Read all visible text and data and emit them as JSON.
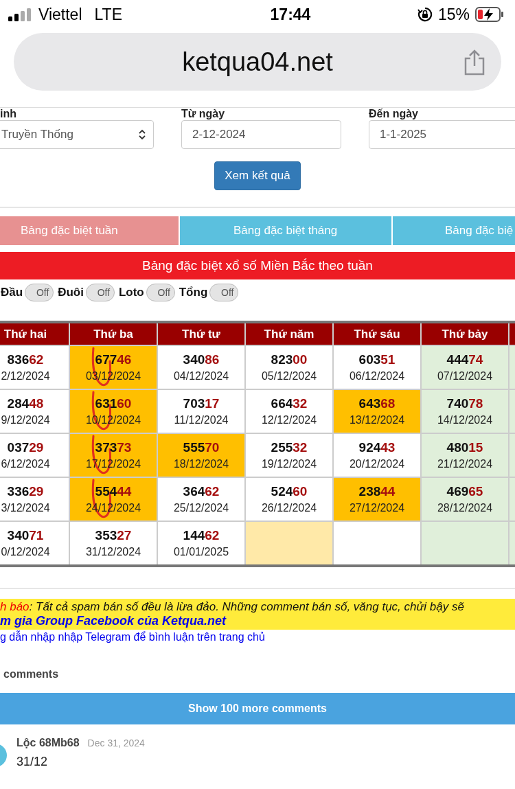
{
  "status_bar": {
    "carrier": "Viettel",
    "network": "LTE",
    "time": "17:44",
    "battery": "15%"
  },
  "address_bar": {
    "url": "ketqua04.net"
  },
  "filters": [
    {
      "kind": "select",
      "label": "inh",
      "value": "Truyền Thống"
    },
    {
      "kind": "date",
      "label": "Từ ngày",
      "value": "2-12-2024"
    },
    {
      "kind": "date",
      "label": "Đến ngày",
      "value": "1-1-2025"
    }
  ],
  "submit_button": "Xem kết quả",
  "tabs": [
    {
      "label": "Bảng đặc biệt tuần",
      "selected": true
    },
    {
      "label": "Bảng đặc biệt tháng",
      "selected": false
    },
    {
      "label": "Bảng đặc biệ",
      "selected": false
    }
  ],
  "banner": "Bảng đặc biệt xổ số Miền Bắc theo tuần",
  "toggles": [
    {
      "label": "Đầu",
      "state": "Off",
      "on": false
    },
    {
      "label": "Đuôi",
      "state": "Off",
      "on": false
    },
    {
      "label": "Loto",
      "state": "Off",
      "on": false
    },
    {
      "label": "Tổng",
      "state": "Off",
      "on": false
    }
  ],
  "table": {
    "columns": [
      {
        "label": "Thứ hai",
        "weekend": false
      },
      {
        "label": "Thứ ba",
        "weekend": false
      },
      {
        "label": "Thứ tư",
        "weekend": false
      },
      {
        "label": "Thứ năm",
        "weekend": false
      },
      {
        "label": "Thứ sáu",
        "weekend": false
      },
      {
        "label": "Thứ bảy",
        "weekend": true
      },
      {
        "weekend": true
      }
    ],
    "rows": [
      [
        {
          "head": "836",
          "tail": "62",
          "date": "2/12/2024",
          "highlighted": false
        },
        {
          "head": "677",
          "tail": "46",
          "date": "03/12/2024",
          "highlighted": true,
          "circled": true
        },
        {
          "head": "340",
          "tail": "86",
          "date": "04/12/2024",
          "highlighted": false
        },
        {
          "head": "823",
          "tail": "00",
          "date": "05/12/2024",
          "highlighted": false
        },
        {
          "head": "603",
          "tail": "51",
          "date": "06/12/2024",
          "highlighted": false
        },
        {
          "head": "444",
          "tail": "74",
          "date": "07/12/2024",
          "highlighted": false
        },
        {
          "highlighted": false
        }
      ],
      [
        {
          "head": "284",
          "tail": "48",
          "date": "9/12/2024",
          "highlighted": false
        },
        {
          "head": "631",
          "tail": "60",
          "date": "10/12/2024",
          "highlighted": true,
          "circled": true
        },
        {
          "head": "703",
          "tail": "17",
          "date": "11/12/2024",
          "highlighted": false
        },
        {
          "head": "664",
          "tail": "32",
          "date": "12/12/2024",
          "highlighted": false
        },
        {
          "head": "643",
          "tail": "68",
          "date": "13/12/2024",
          "highlighted": true
        },
        {
          "head": "740",
          "tail": "78",
          "date": "14/12/2024",
          "highlighted": false
        },
        {
          "highlighted": false
        }
      ],
      [
        {
          "head": "037",
          "tail": "29",
          "date": "6/12/2024",
          "highlighted": false
        },
        {
          "head": "373",
          "tail": "73",
          "date": "17/12/2024",
          "highlighted": true,
          "circled": true
        },
        {
          "head": "555",
          "tail": "70",
          "date": "18/12/2024",
          "highlighted": true
        },
        {
          "head": "255",
          "tail": "32",
          "date": "19/12/2024",
          "highlighted": false
        },
        {
          "head": "924",
          "tail": "43",
          "date": "20/12/2024",
          "highlighted": false
        },
        {
          "head": "480",
          "tail": "15",
          "date": "21/12/2024",
          "highlighted": false
        },
        {
          "highlighted": false
        }
      ],
      [
        {
          "head": "336",
          "tail": "29",
          "date": "3/12/2024",
          "highlighted": false
        },
        {
          "head": "554",
          "tail": "44",
          "date": "24/12/2024",
          "highlighted": true,
          "circled": true
        },
        {
          "head": "364",
          "tail": "62",
          "date": "25/12/2024",
          "highlighted": false
        },
        {
          "head": "524",
          "tail": "60",
          "date": "26/12/2024",
          "highlighted": false
        },
        {
          "head": "238",
          "tail": "44",
          "date": "27/12/2024",
          "highlighted": true
        },
        {
          "head": "469",
          "tail": "65",
          "date": "28/12/2024",
          "highlighted": false
        },
        {
          "highlighted": false
        }
      ],
      [
        {
          "head": "340",
          "tail": "71",
          "date": "0/12/2024",
          "highlighted": false
        },
        {
          "head": "353",
          "tail": "27",
          "date": "31/12/2024",
          "highlighted": false
        },
        {
          "head": "144",
          "tail": "62",
          "date": "01/01/2025",
          "highlighted": false
        },
        {
          "highlighted": false,
          "today": true
        },
        {
          "highlighted": false
        },
        {
          "highlighted": false
        },
        {
          "highlighted": false
        }
      ]
    ]
  },
  "notice": {
    "label": "h báo",
    "message": ": Tất cả spam bán số đều là lừa đảo. Những comment bán số, văng tục, chửi bậy sẽ",
    "group_link": "m gia Group Facebook của Ketqua.net"
  },
  "telegram_link": "g dẫn nhập nhập Telegram để bình luận trên trang chủ",
  "comments": {
    "count_label": "comments",
    "more_button": "Show 100 more comments",
    "items": [
      {
        "author": "Lộc 68Mb68",
        "date": "Dec 31, 2024",
        "text": "31/12"
      }
    ]
  }
}
